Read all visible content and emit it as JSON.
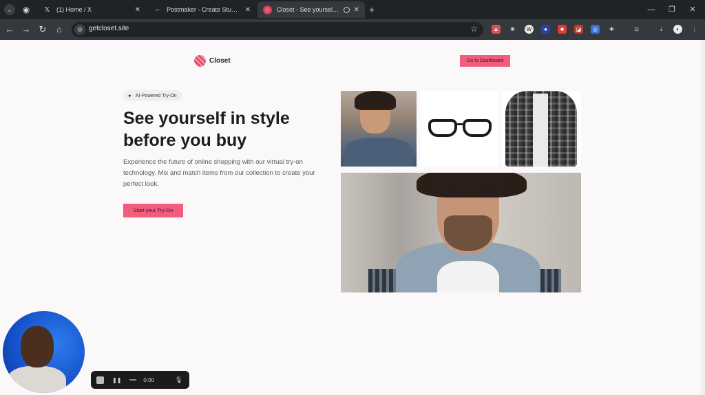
{
  "browser": {
    "tabs": [
      {
        "title": "(1) Home / X",
        "favicon": "x-logo-icon",
        "active": false
      },
      {
        "title": "Postmaker - Create Stunning S",
        "favicon": "dash-icon",
        "active": false
      },
      {
        "title": "Closet - See yourself in styl",
        "favicon": "closet-logo-icon",
        "active": true
      }
    ],
    "new_tab_label": "+",
    "url": "getcloset.site"
  },
  "page": {
    "brand": "Closet",
    "dashboard_button": "Go to Dashboard",
    "badge": "AI-Powered Try-On",
    "hero_title": "See yourself in style before you buy",
    "hero_description": "Experience the future of online shopping with our virtual try-on technology. Mix and match items from our collection to create your perfect look.",
    "cta_button": "Start your Try-On",
    "accent_color": "#f25c7d"
  },
  "recorder": {
    "time": "0:00"
  }
}
